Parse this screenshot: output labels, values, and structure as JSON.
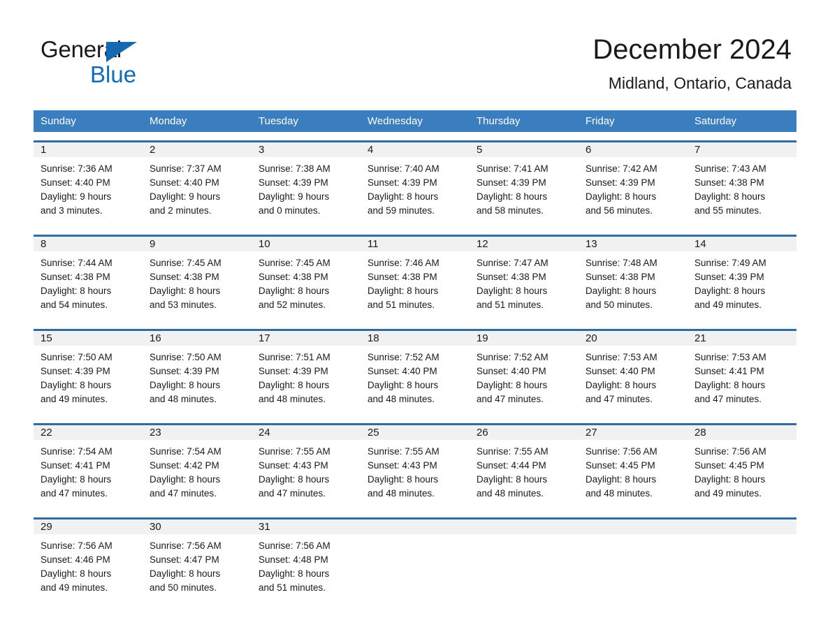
{
  "brand": {
    "name_part1": "General",
    "name_part2": "Blue",
    "accent_color": "#0f6cb6",
    "triangle_icon": "triangle-icon"
  },
  "header": {
    "month_title": "December 2024",
    "location": "Midland, Ontario, Canada",
    "header_bg": "#3a7ebf",
    "row_rule_color": "#2e6da4",
    "daynum_bg": "#f1f1f1"
  },
  "day_headers": [
    "Sunday",
    "Monday",
    "Tuesday",
    "Wednesday",
    "Thursday",
    "Friday",
    "Saturday"
  ],
  "weeks": [
    {
      "days": [
        {
          "num": "1",
          "sunrise": "Sunrise: 7:36 AM",
          "sunset": "Sunset: 4:40 PM",
          "daylight1": "Daylight: 9 hours",
          "daylight2": "and 3 minutes."
        },
        {
          "num": "2",
          "sunrise": "Sunrise: 7:37 AM",
          "sunset": "Sunset: 4:40 PM",
          "daylight1": "Daylight: 9 hours",
          "daylight2": "and 2 minutes."
        },
        {
          "num": "3",
          "sunrise": "Sunrise: 7:38 AM",
          "sunset": "Sunset: 4:39 PM",
          "daylight1": "Daylight: 9 hours",
          "daylight2": "and 0 minutes."
        },
        {
          "num": "4",
          "sunrise": "Sunrise: 7:40 AM",
          "sunset": "Sunset: 4:39 PM",
          "daylight1": "Daylight: 8 hours",
          "daylight2": "and 59 minutes."
        },
        {
          "num": "5",
          "sunrise": "Sunrise: 7:41 AM",
          "sunset": "Sunset: 4:39 PM",
          "daylight1": "Daylight: 8 hours",
          "daylight2": "and 58 minutes."
        },
        {
          "num": "6",
          "sunrise": "Sunrise: 7:42 AM",
          "sunset": "Sunset: 4:39 PM",
          "daylight1": "Daylight: 8 hours",
          "daylight2": "and 56 minutes."
        },
        {
          "num": "7",
          "sunrise": "Sunrise: 7:43 AM",
          "sunset": "Sunset: 4:38 PM",
          "daylight1": "Daylight: 8 hours",
          "daylight2": "and 55 minutes."
        }
      ]
    },
    {
      "days": [
        {
          "num": "8",
          "sunrise": "Sunrise: 7:44 AM",
          "sunset": "Sunset: 4:38 PM",
          "daylight1": "Daylight: 8 hours",
          "daylight2": "and 54 minutes."
        },
        {
          "num": "9",
          "sunrise": "Sunrise: 7:45 AM",
          "sunset": "Sunset: 4:38 PM",
          "daylight1": "Daylight: 8 hours",
          "daylight2": "and 53 minutes."
        },
        {
          "num": "10",
          "sunrise": "Sunrise: 7:45 AM",
          "sunset": "Sunset: 4:38 PM",
          "daylight1": "Daylight: 8 hours",
          "daylight2": "and 52 minutes."
        },
        {
          "num": "11",
          "sunrise": "Sunrise: 7:46 AM",
          "sunset": "Sunset: 4:38 PM",
          "daylight1": "Daylight: 8 hours",
          "daylight2": "and 51 minutes."
        },
        {
          "num": "12",
          "sunrise": "Sunrise: 7:47 AM",
          "sunset": "Sunset: 4:38 PM",
          "daylight1": "Daylight: 8 hours",
          "daylight2": "and 51 minutes."
        },
        {
          "num": "13",
          "sunrise": "Sunrise: 7:48 AM",
          "sunset": "Sunset: 4:38 PM",
          "daylight1": "Daylight: 8 hours",
          "daylight2": "and 50 minutes."
        },
        {
          "num": "14",
          "sunrise": "Sunrise: 7:49 AM",
          "sunset": "Sunset: 4:39 PM",
          "daylight1": "Daylight: 8 hours",
          "daylight2": "and 49 minutes."
        }
      ]
    },
    {
      "days": [
        {
          "num": "15",
          "sunrise": "Sunrise: 7:50 AM",
          "sunset": "Sunset: 4:39 PM",
          "daylight1": "Daylight: 8 hours",
          "daylight2": "and 49 minutes."
        },
        {
          "num": "16",
          "sunrise": "Sunrise: 7:50 AM",
          "sunset": "Sunset: 4:39 PM",
          "daylight1": "Daylight: 8 hours",
          "daylight2": "and 48 minutes."
        },
        {
          "num": "17",
          "sunrise": "Sunrise: 7:51 AM",
          "sunset": "Sunset: 4:39 PM",
          "daylight1": "Daylight: 8 hours",
          "daylight2": "and 48 minutes."
        },
        {
          "num": "18",
          "sunrise": "Sunrise: 7:52 AM",
          "sunset": "Sunset: 4:40 PM",
          "daylight1": "Daylight: 8 hours",
          "daylight2": "and 48 minutes."
        },
        {
          "num": "19",
          "sunrise": "Sunrise: 7:52 AM",
          "sunset": "Sunset: 4:40 PM",
          "daylight1": "Daylight: 8 hours",
          "daylight2": "and 47 minutes."
        },
        {
          "num": "20",
          "sunrise": "Sunrise: 7:53 AM",
          "sunset": "Sunset: 4:40 PM",
          "daylight1": "Daylight: 8 hours",
          "daylight2": "and 47 minutes."
        },
        {
          "num": "21",
          "sunrise": "Sunrise: 7:53 AM",
          "sunset": "Sunset: 4:41 PM",
          "daylight1": "Daylight: 8 hours",
          "daylight2": "and 47 minutes."
        }
      ]
    },
    {
      "days": [
        {
          "num": "22",
          "sunrise": "Sunrise: 7:54 AM",
          "sunset": "Sunset: 4:41 PM",
          "daylight1": "Daylight: 8 hours",
          "daylight2": "and 47 minutes."
        },
        {
          "num": "23",
          "sunrise": "Sunrise: 7:54 AM",
          "sunset": "Sunset: 4:42 PM",
          "daylight1": "Daylight: 8 hours",
          "daylight2": "and 47 minutes."
        },
        {
          "num": "24",
          "sunrise": "Sunrise: 7:55 AM",
          "sunset": "Sunset: 4:43 PM",
          "daylight1": "Daylight: 8 hours",
          "daylight2": "and 47 minutes."
        },
        {
          "num": "25",
          "sunrise": "Sunrise: 7:55 AM",
          "sunset": "Sunset: 4:43 PM",
          "daylight1": "Daylight: 8 hours",
          "daylight2": "and 48 minutes."
        },
        {
          "num": "26",
          "sunrise": "Sunrise: 7:55 AM",
          "sunset": "Sunset: 4:44 PM",
          "daylight1": "Daylight: 8 hours",
          "daylight2": "and 48 minutes."
        },
        {
          "num": "27",
          "sunrise": "Sunrise: 7:56 AM",
          "sunset": "Sunset: 4:45 PM",
          "daylight1": "Daylight: 8 hours",
          "daylight2": "and 48 minutes."
        },
        {
          "num": "28",
          "sunrise": "Sunrise: 7:56 AM",
          "sunset": "Sunset: 4:45 PM",
          "daylight1": "Daylight: 8 hours",
          "daylight2": "and 49 minutes."
        }
      ]
    },
    {
      "days": [
        {
          "num": "29",
          "sunrise": "Sunrise: 7:56 AM",
          "sunset": "Sunset: 4:46 PM",
          "daylight1": "Daylight: 8 hours",
          "daylight2": "and 49 minutes."
        },
        {
          "num": "30",
          "sunrise": "Sunrise: 7:56 AM",
          "sunset": "Sunset: 4:47 PM",
          "daylight1": "Daylight: 8 hours",
          "daylight2": "and 50 minutes."
        },
        {
          "num": "31",
          "sunrise": "Sunrise: 7:56 AM",
          "sunset": "Sunset: 4:48 PM",
          "daylight1": "Daylight: 8 hours",
          "daylight2": "and 51 minutes."
        },
        {
          "num": "",
          "sunrise": "",
          "sunset": "",
          "daylight1": "",
          "daylight2": ""
        },
        {
          "num": "",
          "sunrise": "",
          "sunset": "",
          "daylight1": "",
          "daylight2": ""
        },
        {
          "num": "",
          "sunrise": "",
          "sunset": "",
          "daylight1": "",
          "daylight2": ""
        },
        {
          "num": "",
          "sunrise": "",
          "sunset": "",
          "daylight1": "",
          "daylight2": ""
        }
      ]
    }
  ]
}
